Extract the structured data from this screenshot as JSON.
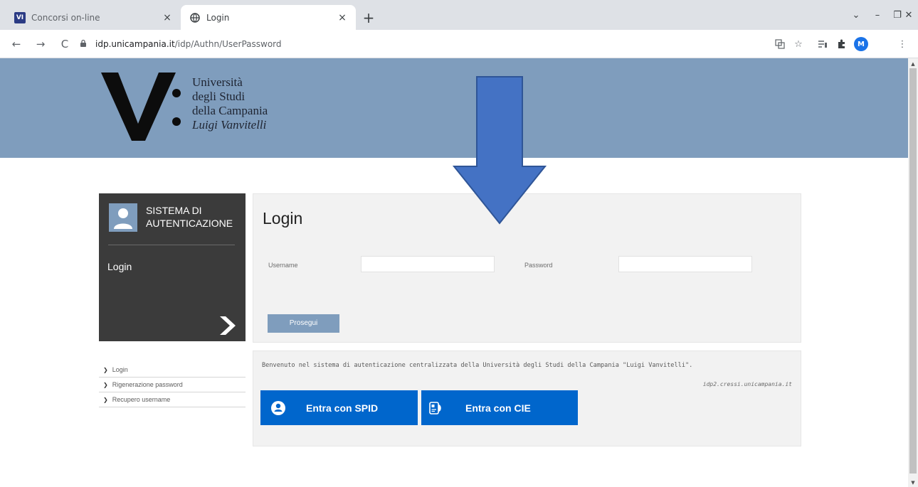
{
  "browser": {
    "tabs": [
      {
        "title": "Concorsi on-line",
        "favicon": "VI",
        "active": false,
        "close": "×"
      },
      {
        "title": "Login",
        "favicon": "globe-icon",
        "active": true,
        "close": "×"
      }
    ],
    "new_tab": "+",
    "window_controls": {
      "minimize": "–",
      "restore": "❐",
      "close": "✕",
      "tab_search": "⌄"
    },
    "nav": {
      "back": "←",
      "forward": "→",
      "reload": "C"
    },
    "url": {
      "host": "idp.unicampania.it",
      "path": "/idp/Authn/UserPassword"
    },
    "toolbar_icons": [
      "translate-icon",
      "star-icon",
      "reading-list-icon",
      "extensions-icon",
      "profile-icon",
      "menu-icon"
    ],
    "profile_initial": "M",
    "menu": "⋮"
  },
  "banner": {
    "bg_color": "#7f9dbd",
    "logo_lines": [
      "Università",
      "degli Studi",
      "della Campania"
    ],
    "logo_italic": "Luigi Vanvitelli"
  },
  "sidebar": {
    "title": "SISTEMA DI AUTENTICAZIONE",
    "current": "Login",
    "links": [
      {
        "label": "Login"
      },
      {
        "label": "Rigenerazione password"
      },
      {
        "label": "Recupero username"
      }
    ]
  },
  "login": {
    "title": "Login",
    "username_label": "Username",
    "username_value": "",
    "password_label": "Password",
    "password_value": "",
    "submit_label": "Prosegui"
  },
  "info": {
    "welcome": "Benvenuto nel sistema di autenticazione centralizzata della Università degli Studi della Campania \"Luigi Vanvitelli\".",
    "server": "idp2.cressi.unicampania.it",
    "spid_label": "Entra con SPID",
    "cie_label": "Entra con CIE",
    "button_color": "#0066cc"
  },
  "annotation": {
    "arrow_color": "#4472c4",
    "arrow_direction": "down"
  }
}
